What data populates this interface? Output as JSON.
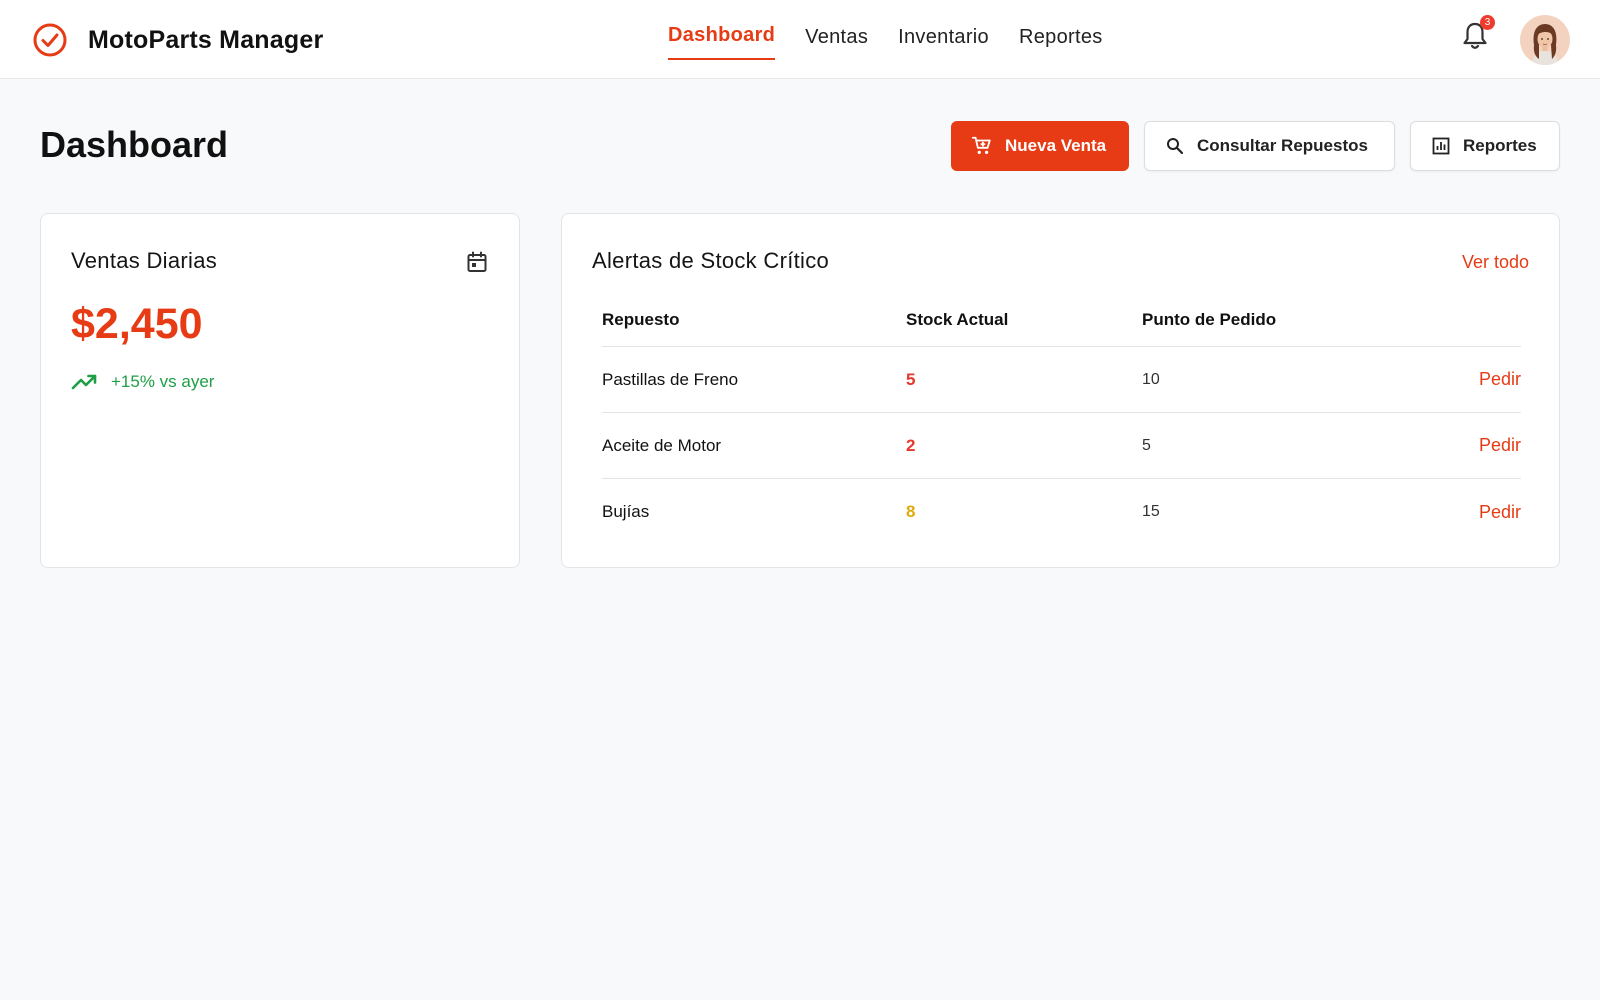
{
  "app": {
    "name": "MotoParts Manager",
    "accent_color": "#e63b14"
  },
  "nav": {
    "items": [
      {
        "label": "Dashboard",
        "active": true
      },
      {
        "label": "Ventas",
        "active": false
      },
      {
        "label": "Inventario",
        "active": false
      },
      {
        "label": "Reportes",
        "active": false
      }
    ]
  },
  "header": {
    "notifications_count": "3",
    "bell_icon": "bell-icon",
    "avatar_icon": "user-avatar"
  },
  "page": {
    "title": "Dashboard"
  },
  "actions": {
    "new_sale": {
      "label": "Nueva Venta",
      "icon": "cart-icon"
    },
    "search_parts": {
      "label": "Consultar Repuestos",
      "icon": "search-icon"
    },
    "reports": {
      "label": "Reportes",
      "icon": "bar-chart-icon"
    }
  },
  "sales_card": {
    "title": "Ventas Diarias",
    "icon": "calendar-icon",
    "amount": "$2,450",
    "trend_text": "+15% vs ayer",
    "trend_color": "#1e9e46"
  },
  "alerts_card": {
    "title": "Alertas de Stock Crítico",
    "see_all": "Ver todo",
    "columns": [
      "Repuesto",
      "Stock Actual",
      "Punto de Pedido"
    ],
    "rows": [
      {
        "part": "Pastillas de Freno",
        "stock": "5",
        "stock_color": "#e5372b",
        "reorder_point": "10",
        "action": "Pedir"
      },
      {
        "part": "Aceite de Motor",
        "stock": "2",
        "stock_color": "#e5372b",
        "reorder_point": "5",
        "action": "Pedir"
      },
      {
        "part": "Bujías",
        "stock": "8",
        "stock_color": "#e2a90c",
        "reorder_point": "15",
        "action": "Pedir"
      }
    ]
  }
}
